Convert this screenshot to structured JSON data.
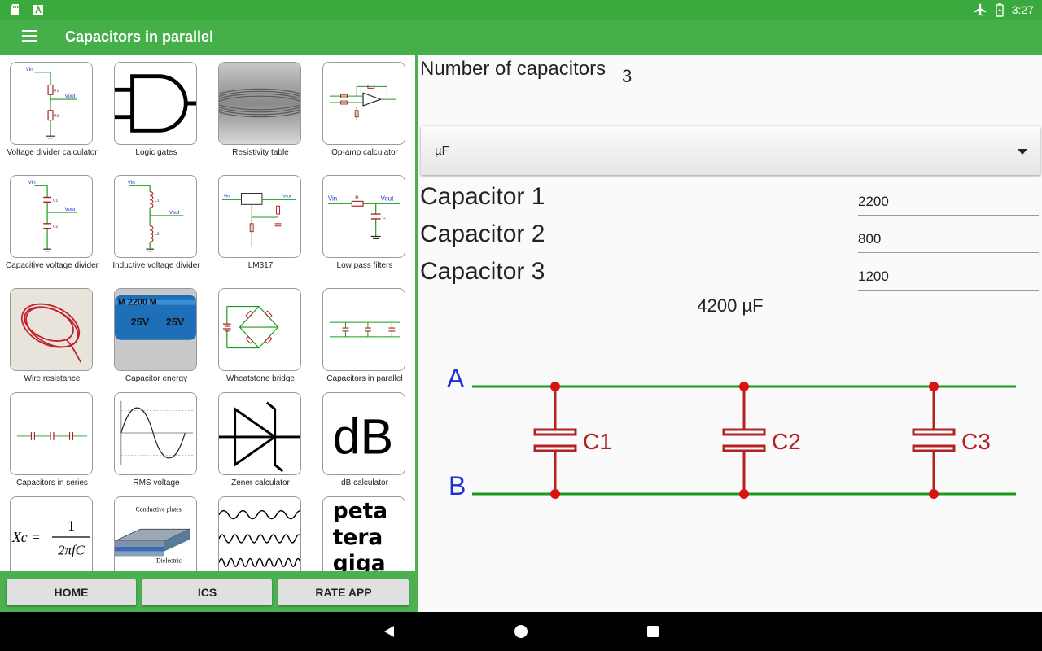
{
  "status_bar": {
    "time": "3:27"
  },
  "app_bar": {
    "title": "Capacitors in parallel"
  },
  "tiles": [
    {
      "label": "Voltage divider calculator"
    },
    {
      "label": "Logic gates"
    },
    {
      "label": "Resistivity table"
    },
    {
      "label": "Op-amp calculator"
    },
    {
      "label": "Capacitive voltage divider"
    },
    {
      "label": "Inductive voltage divider"
    },
    {
      "label": "LM317"
    },
    {
      "label": "Low pass filters"
    },
    {
      "label": "Wire resistance"
    },
    {
      "label": "Capacitor energy"
    },
    {
      "label": "Wheatstone bridge"
    },
    {
      "label": "Capacitors in parallel"
    },
    {
      "label": "Capacitors in series"
    },
    {
      "label": "RMS voltage"
    },
    {
      "label": "Zener calculator"
    },
    {
      "label": "dB calculator"
    },
    {
      "label": ""
    },
    {
      "label": ""
    },
    {
      "label": ""
    },
    {
      "label": ""
    }
  ],
  "thumb_text": {
    "vin": "Vin",
    "vout": "Vout",
    "r1": "R1",
    "r2": "R2",
    "c1": "C1",
    "c2": "C2",
    "l1": "L1",
    "l2": "L2",
    "r": "R",
    "c": "C",
    "cap_marking": "M 2200 M",
    "cap_voltage": "25V",
    "db": "dB",
    "reactance_lhs": "Xc =",
    "reactance_num": "1",
    "reactance_den": "2πfC",
    "conductive_plates": "Conductive plates",
    "dielectric": "Dielectric",
    "prefix_1": "peta",
    "prefix_2": "tera",
    "prefix_3": "giga"
  },
  "bottom_buttons": {
    "home": "HOME",
    "ics": "ICS",
    "rate": "RATE APP"
  },
  "calculator": {
    "num_label": "Number of capacitors",
    "num_value": "3",
    "unit": "µF",
    "capacitors": [
      {
        "label": "Capacitor 1",
        "value": "2200"
      },
      {
        "label": "Capacitor 2",
        "value": "800"
      },
      {
        "label": "Capacitor 3",
        "value": "1200"
      }
    ],
    "result": "4200 µF"
  },
  "circuit": {
    "node_a": "A",
    "node_b": "B",
    "labels": [
      "C1",
      "C2",
      "C3"
    ],
    "wire_color": "#1a9a1a",
    "component_color": "#b22222",
    "node_label_color": "#1f2fd6"
  }
}
